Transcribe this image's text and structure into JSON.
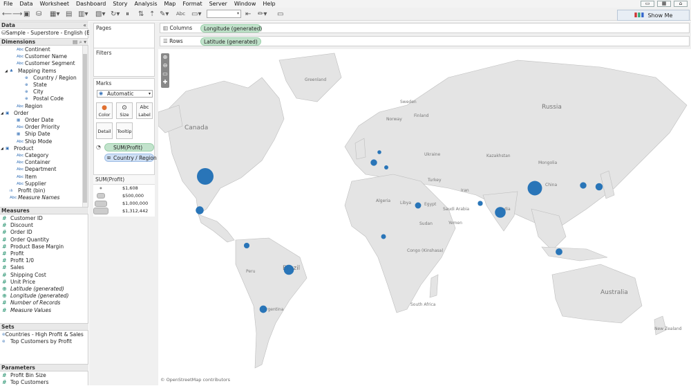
{
  "menu": [
    "File",
    "Data",
    "Worksheet",
    "Dashboard",
    "Story",
    "Analysis",
    "Map",
    "Format",
    "Server",
    "Window",
    "Help"
  ],
  "toolbar": {
    "label_text": "Abc",
    "show_me": "Show Me"
  },
  "left_panel": {
    "data_header": "Data",
    "datasource": "Sample - Superstore - English (Ext...",
    "dimensions_header": "Dimensions",
    "dimensions": [
      {
        "label": "Continent",
        "icon": "Abc",
        "indent": 1
      },
      {
        "label": "Customer Name",
        "icon": "Abc",
        "indent": 1
      },
      {
        "label": "Customer Segment",
        "icon": "Abc",
        "indent": 1
      },
      {
        "label": "Mapping items",
        "icon": "hierarchy",
        "indent": 0
      },
      {
        "label": "Country / Region",
        "icon": "globe",
        "indent": 2
      },
      {
        "label": "State",
        "icon": "globe",
        "indent": 2
      },
      {
        "label": "City",
        "icon": "globe",
        "indent": 2
      },
      {
        "label": "Postal Code",
        "icon": "globe",
        "indent": 2
      },
      {
        "label": "Region",
        "icon": "Abc",
        "indent": 1
      },
      {
        "label": "Order",
        "icon": "folder",
        "indent": -1
      },
      {
        "label": "Order Date",
        "icon": "calendar",
        "indent": 1
      },
      {
        "label": "Order Priority",
        "icon": "Abc",
        "indent": 1
      },
      {
        "label": "Ship Date",
        "icon": "calendar",
        "indent": 1
      },
      {
        "label": "Ship Mode",
        "icon": "Abc",
        "indent": 1
      },
      {
        "label": "Product",
        "icon": "folder",
        "indent": -1
      },
      {
        "label": "Category",
        "icon": "Abc",
        "indent": 1
      },
      {
        "label": "Container",
        "icon": "Abc",
        "indent": 1
      },
      {
        "label": "Department",
        "icon": "Abc",
        "indent": 1
      },
      {
        "label": "Item",
        "icon": "Abc",
        "indent": 1
      },
      {
        "label": "Supplier",
        "icon": "Abc",
        "indent": 1
      },
      {
        "label": "Profit (bin)",
        "icon": "bin",
        "indent": 0
      },
      {
        "label": "Measure Names",
        "icon": "Abc",
        "indent": 0,
        "italic": true
      }
    ],
    "measures_header": "Measures",
    "measures": [
      {
        "label": "Customer ID"
      },
      {
        "label": "Discount"
      },
      {
        "label": "Order ID"
      },
      {
        "label": "Order Quantity"
      },
      {
        "label": "Product Base Margin"
      },
      {
        "label": "Profit"
      },
      {
        "label": "Profit 1/0"
      },
      {
        "label": "Sales"
      },
      {
        "label": "Shipping Cost"
      },
      {
        "label": "Unit Price"
      },
      {
        "label": "Latitude (generated)",
        "italic": true,
        "globe": true
      },
      {
        "label": "Longitude (generated)",
        "italic": true,
        "globe": true
      },
      {
        "label": "Number of Records",
        "italic": true
      },
      {
        "label": "Measure Values",
        "italic": true
      }
    ],
    "sets_header": "Sets",
    "sets": [
      "Countries - High Profit & Sales",
      "Top Customers by Profit"
    ],
    "parameters_header": "Parameters",
    "parameters": [
      "Profit Bin Size",
      "Top Customers"
    ]
  },
  "pages_title": "Pages",
  "filters_title": "Filters",
  "marks": {
    "title": "Marks",
    "type": "Automatic",
    "buttons": [
      {
        "label": "Color"
      },
      {
        "label": "Size"
      },
      {
        "label": "Label"
      },
      {
        "label": "Detail"
      },
      {
        "label": "Tooltip"
      }
    ],
    "pills": [
      {
        "label": "SUM(Profit)",
        "color": "green"
      },
      {
        "label": "Country / Region",
        "color": "blue"
      }
    ]
  },
  "size_legend": {
    "title": "SUM(Profit)",
    "items": [
      "$1,608",
      "$500,000",
      "$1,000,000",
      "$1,312,442"
    ]
  },
  "shelves": {
    "columns_label": "Columns",
    "columns_pill": "Longitude (generated)",
    "rows_label": "Rows",
    "rows_pill": "Latitude (generated)"
  },
  "map": {
    "attribution": "© OpenStreetMap contributors",
    "mark_color": "#1f6fb5",
    "land_color": "#e4e4e4",
    "labels": [
      "Greenland",
      "Russia",
      "Canada",
      "Sweden",
      "Finland",
      "Norway",
      "Kazakhstan",
      "Mongolia",
      "Ukraine",
      "Turkey",
      "Algeria",
      "Libya",
      "Egypt",
      "Iran",
      "Saudi Arabia",
      "Sudan",
      "Yemen",
      "India",
      "China",
      "Congo (Kinshasa)",
      "South Africa",
      "Brazil",
      "Peru",
      "Argentina",
      "Australia",
      "New Zealand"
    ],
    "marks": [
      {
        "country": "United States",
        "profit": 1312442
      },
      {
        "country": "China",
        "profit": 1000000
      },
      {
        "country": "India",
        "profit": 550000
      },
      {
        "country": "Brazil",
        "profit": 480000
      },
      {
        "country": "Mexico",
        "profit": 300000
      },
      {
        "country": "Argentina",
        "profit": 260000
      },
      {
        "country": "Indonesia",
        "profit": 220000
      },
      {
        "country": "Japan",
        "profit": 250000
      },
      {
        "country": "South Korea",
        "profit": 200000
      },
      {
        "country": "Egypt",
        "profit": 180000
      },
      {
        "country": "France",
        "profit": 200000
      },
      {
        "country": "Colombia",
        "profit": 150000
      },
      {
        "country": "Pakistan",
        "profit": 120000
      },
      {
        "country": "Nigeria",
        "profit": 110000
      },
      {
        "country": "Italy",
        "profit": 80000
      },
      {
        "country": "Germany",
        "profit": 70000
      }
    ]
  }
}
